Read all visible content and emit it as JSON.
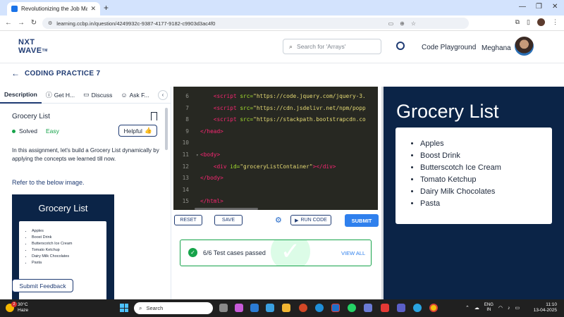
{
  "browser": {
    "tab_title": "Revolutionizing the Job Market",
    "url": "learning.ccbp.in/question/4249932c-9387-4177-9182-c9903d3ac4f0"
  },
  "header": {
    "logo_line1": "NXT",
    "logo_line2": "WAVE",
    "logo_tm": "TM",
    "search_placeholder": "Search for 'Arrays'",
    "playground_label": "Code Playground",
    "username": "Meghana"
  },
  "page": {
    "title": "CODING PRACTICE 7"
  },
  "left_tabs": [
    {
      "label": "Description",
      "icon": "description-icon"
    },
    {
      "label": "Get H...",
      "icon": "help-icon"
    },
    {
      "label": "Discuss",
      "icon": "chat-icon"
    },
    {
      "label": "Ask F...",
      "icon": "people-icon"
    }
  ],
  "problem": {
    "title": "Grocery List",
    "status": "Solved",
    "difficulty": "Easy",
    "helpful_label": "Helpful",
    "description": "In this assignment, let's build a Grocery List dynamically by applying the concepts we learned till now.",
    "refer_text": "Refer to the below image.",
    "preview_title": "Grocery List",
    "preview_items": [
      "Apples",
      "Boost Drink",
      "Butterscotch Ice Cream",
      "Tomato Ketchup",
      "Dairy Milk Chocolates",
      "Pasta"
    ]
  },
  "feedback_label": "Submit Feedback",
  "code_lines": [
    {
      "num": "6",
      "fold": "",
      "indent": "    ",
      "tag_open": "<script",
      "attr": " src=",
      "str": "\"https://code.jquery.com/jquery-3.",
      "tag_close": ""
    },
    {
      "num": "7",
      "fold": "",
      "indent": "    ",
      "tag_open": "<script",
      "attr": " src=",
      "str": "\"https://cdn.jsdelivr.net/npm/popp",
      "tag_close": ""
    },
    {
      "num": "8",
      "fold": "",
      "indent": "    ",
      "tag_open": "<script",
      "attr": " src=",
      "str": "\"https://stackpath.bootstrapcdn.co",
      "tag_close": ""
    },
    {
      "num": "9",
      "fold": "",
      "indent": "",
      "tag_open": "</head>",
      "attr": "",
      "str": "",
      "tag_close": ""
    },
    {
      "num": "10",
      "fold": "",
      "indent": "",
      "tag_open": "",
      "attr": "",
      "str": "",
      "tag_close": ""
    },
    {
      "num": "11",
      "fold": "▾",
      "indent": "",
      "tag_open": "<body>",
      "attr": "",
      "str": "",
      "tag_close": ""
    },
    {
      "num": "12",
      "fold": "",
      "indent": "    ",
      "tag_open": "<div",
      "attr": " id=",
      "str": "\"groceryListContainer\"",
      "tag_close": "></div>"
    },
    {
      "num": "13",
      "fold": "",
      "indent": "",
      "tag_open": "</body>",
      "attr": "",
      "str": "",
      "tag_close": ""
    },
    {
      "num": "14",
      "fold": "",
      "indent": "",
      "tag_open": "",
      "attr": "",
      "str": "",
      "tag_close": ""
    },
    {
      "num": "15",
      "fold": "",
      "indent": "",
      "tag_open": "</html>",
      "attr": "",
      "str": "",
      "tag_close": ""
    }
  ],
  "actions": {
    "reset_label": "RESET",
    "save_label": "SAVE",
    "run_label": "RUN CODE",
    "submit_label": "SUBMIT"
  },
  "result": {
    "text": "6/6 Test cases passed",
    "view_all_label": "VIEW ALL"
  },
  "output": {
    "title": "Grocery List",
    "items": [
      "Apples",
      "Boost Drink",
      "Butterscotch Ice Cream",
      "Tomato Ketchup",
      "Dairy Milk Chocolates",
      "Pasta"
    ]
  },
  "taskbar": {
    "weather_badge": "2",
    "temperature": "30°C",
    "condition": "Haze",
    "search_placeholder": "Search",
    "lang_line1": "ENG",
    "lang_line2": "IN",
    "time": "11:10",
    "date": "13-04-2025"
  },
  "colors": {
    "brand_dark": "#1f3b73",
    "editor_bg": "#272822",
    "output_bg": "#0b2447",
    "success": "#16a34a",
    "submit": "#2f80ed"
  }
}
